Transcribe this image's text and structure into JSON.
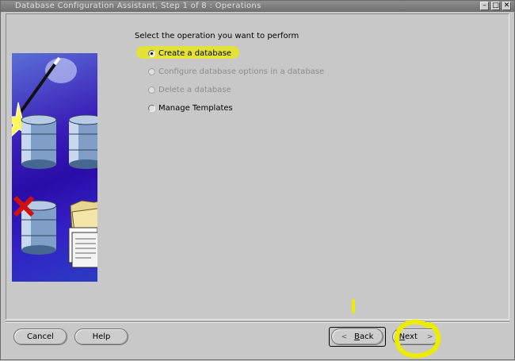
{
  "window": {
    "title": "Database Configuration Assistant, Step 1 of 8 : Operations",
    "minimize_glyph": "–",
    "maximize_glyph": "□",
    "close_glyph": "✕"
  },
  "main": {
    "prompt": "Select the operation you want to perform",
    "options": [
      {
        "label": "Create a database",
        "selected": true,
        "enabled": true
      },
      {
        "label": "Configure database options in a database",
        "selected": false,
        "enabled": false
      },
      {
        "label": "Delete a database",
        "selected": false,
        "enabled": false
      },
      {
        "label": "Manage Templates",
        "selected": false,
        "enabled": true
      }
    ]
  },
  "buttons": {
    "cancel": "Cancel",
    "help": "Help",
    "back_mnemonic": "B",
    "back_rest": "ack",
    "next_mnemonic": "N",
    "next_rest": "ext",
    "back_arrow": "<",
    "next_arrow": ">"
  },
  "colors": {
    "annotation_highlight": "#ecec00",
    "illustration_blue": "#2a0ca8"
  },
  "icons": [
    "magic-wand-icon",
    "database-cylinder-icon",
    "checkbox-checked-icon",
    "delete-x-icon",
    "folder-icon",
    "documents-icon"
  ]
}
